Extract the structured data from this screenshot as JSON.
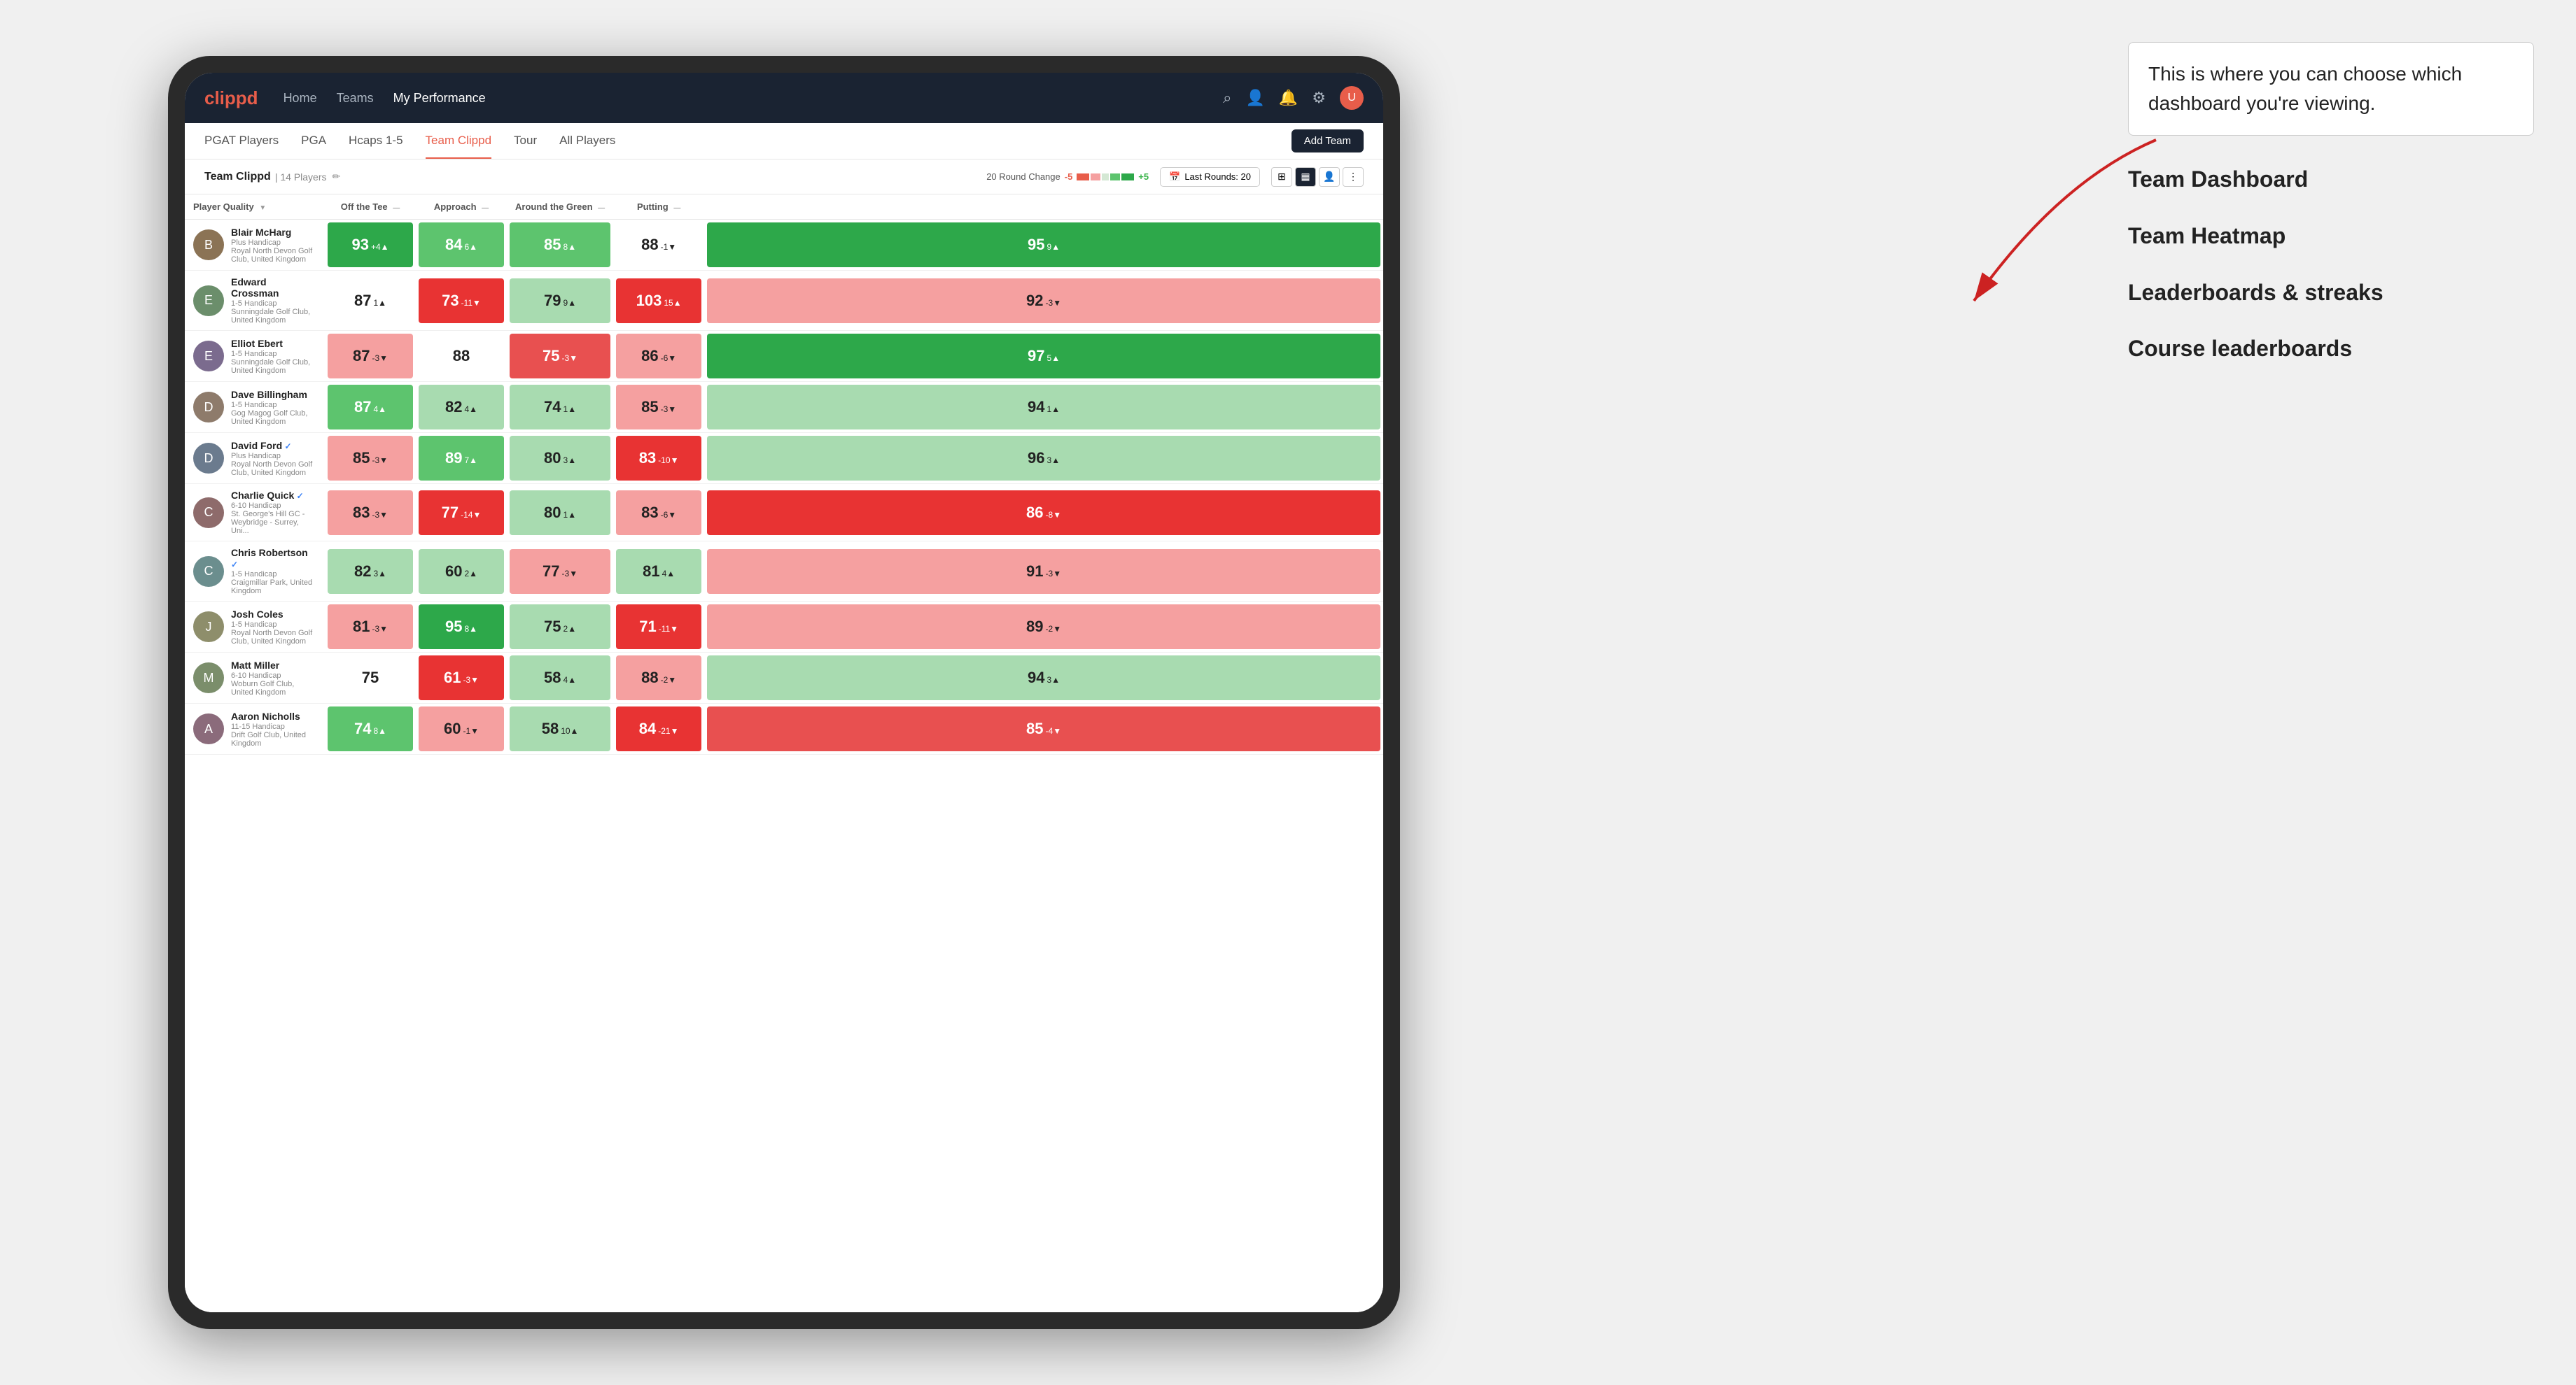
{
  "annotation": {
    "bubble_text": "This is where you can choose which dashboard you're viewing.",
    "items": [
      "Team Dashboard",
      "Team Heatmap",
      "Leaderboards & streaks",
      "Course leaderboards"
    ]
  },
  "nav": {
    "logo": "clippd",
    "links": [
      "Home",
      "Teams",
      "My Performance"
    ],
    "active_link": "My Performance"
  },
  "sub_nav": {
    "links": [
      "PGAT Players",
      "PGA",
      "Hcaps 1-5",
      "Team Clippd",
      "Tour",
      "All Players"
    ],
    "active": "Team Clippd",
    "add_team_label": "Add Team"
  },
  "team_header": {
    "name": "Team Clippd",
    "separator": "|",
    "count": "14 Players",
    "round_change_label": "20 Round Change",
    "change_neg": "-5",
    "change_pos": "+5",
    "last_rounds_label": "Last Rounds: 20"
  },
  "columns": {
    "player_quality": "Player Quality",
    "off_tee": "Off the Tee",
    "approach": "Approach",
    "around_green": "Around the Green",
    "putting": "Putting"
  },
  "players": [
    {
      "name": "Blair McHarg",
      "handicap": "Plus Handicap",
      "club": "Royal North Devon Golf Club, United Kingdom",
      "verified": false,
      "player_quality": {
        "value": 93,
        "change": "+4",
        "dir": "up",
        "color": "green-dark"
      },
      "off_tee": {
        "value": 84,
        "change": "6",
        "dir": "up",
        "color": "green-med"
      },
      "approach": {
        "value": 85,
        "change": "8",
        "dir": "up",
        "color": "green-med"
      },
      "around_green": {
        "value": 88,
        "change": "-1",
        "dir": "down",
        "color": "white-cell"
      },
      "putting": {
        "value": 95,
        "change": "9",
        "dir": "up",
        "color": "green-dark"
      }
    },
    {
      "name": "Edward Crossman",
      "handicap": "1-5 Handicap",
      "club": "Sunningdale Golf Club, United Kingdom",
      "verified": false,
      "player_quality": {
        "value": 87,
        "change": "1",
        "dir": "up",
        "color": "white-cell"
      },
      "off_tee": {
        "value": 73,
        "change": "-11",
        "dir": "down",
        "color": "red-dark"
      },
      "approach": {
        "value": 79,
        "change": "9",
        "dir": "up",
        "color": "green-light"
      },
      "around_green": {
        "value": 103,
        "change": "15",
        "dir": "up",
        "color": "red-dark"
      },
      "putting": {
        "value": 92,
        "change": "-3",
        "dir": "down",
        "color": "red-light"
      }
    },
    {
      "name": "Elliot Ebert",
      "handicap": "1-5 Handicap",
      "club": "Sunningdale Golf Club, United Kingdom",
      "verified": false,
      "player_quality": {
        "value": 87,
        "change": "-3",
        "dir": "down",
        "color": "red-light"
      },
      "off_tee": {
        "value": 88,
        "change": "",
        "dir": "none",
        "color": "white-cell"
      },
      "approach": {
        "value": 75,
        "change": "-3",
        "dir": "down",
        "color": "red-med"
      },
      "around_green": {
        "value": 86,
        "change": "-6",
        "dir": "down",
        "color": "red-light"
      },
      "putting": {
        "value": 97,
        "change": "5",
        "dir": "up",
        "color": "green-dark"
      }
    },
    {
      "name": "Dave Billingham",
      "handicap": "1-5 Handicap",
      "club": "Gog Magog Golf Club, United Kingdom",
      "verified": false,
      "player_quality": {
        "value": 87,
        "change": "4",
        "dir": "up",
        "color": "green-med"
      },
      "off_tee": {
        "value": 82,
        "change": "4",
        "dir": "up",
        "color": "green-light"
      },
      "approach": {
        "value": 74,
        "change": "1",
        "dir": "up",
        "color": "green-light"
      },
      "around_green": {
        "value": 85,
        "change": "-3",
        "dir": "down",
        "color": "red-light"
      },
      "putting": {
        "value": 94,
        "change": "1",
        "dir": "up",
        "color": "green-light"
      }
    },
    {
      "name": "David Ford",
      "handicap": "Plus Handicap",
      "club": "Royal North Devon Golf Club, United Kingdom",
      "verified": true,
      "player_quality": {
        "value": 85,
        "change": "-3",
        "dir": "down",
        "color": "red-light"
      },
      "off_tee": {
        "value": 89,
        "change": "7",
        "dir": "up",
        "color": "green-med"
      },
      "approach": {
        "value": 80,
        "change": "3",
        "dir": "up",
        "color": "green-light"
      },
      "around_green": {
        "value": 83,
        "change": "-10",
        "dir": "down",
        "color": "red-dark"
      },
      "putting": {
        "value": 96,
        "change": "3",
        "dir": "up",
        "color": "green-light"
      }
    },
    {
      "name": "Charlie Quick",
      "handicap": "6-10 Handicap",
      "club": "St. George's Hill GC - Weybridge - Surrey, Uni...",
      "verified": true,
      "player_quality": {
        "value": 83,
        "change": "-3",
        "dir": "down",
        "color": "red-light"
      },
      "off_tee": {
        "value": 77,
        "change": "-14",
        "dir": "down",
        "color": "red-dark"
      },
      "approach": {
        "value": 80,
        "change": "1",
        "dir": "up",
        "color": "green-light"
      },
      "around_green": {
        "value": 83,
        "change": "-6",
        "dir": "down",
        "color": "red-light"
      },
      "putting": {
        "value": 86,
        "change": "-8",
        "dir": "down",
        "color": "red-dark"
      }
    },
    {
      "name": "Chris Robertson",
      "handicap": "1-5 Handicap",
      "club": "Craigmillar Park, United Kingdom",
      "verified": true,
      "player_quality": {
        "value": 82,
        "change": "3",
        "dir": "up",
        "color": "green-light"
      },
      "off_tee": {
        "value": 60,
        "change": "2",
        "dir": "up",
        "color": "green-light"
      },
      "approach": {
        "value": 77,
        "change": "-3",
        "dir": "down",
        "color": "red-light"
      },
      "around_green": {
        "value": 81,
        "change": "4",
        "dir": "up",
        "color": "green-light"
      },
      "putting": {
        "value": 91,
        "change": "-3",
        "dir": "down",
        "color": "red-light"
      }
    },
    {
      "name": "Josh Coles",
      "handicap": "1-5 Handicap",
      "club": "Royal North Devon Golf Club, United Kingdom",
      "verified": false,
      "player_quality": {
        "value": 81,
        "change": "-3",
        "dir": "down",
        "color": "red-light"
      },
      "off_tee": {
        "value": 95,
        "change": "8",
        "dir": "up",
        "color": "green-dark"
      },
      "approach": {
        "value": 75,
        "change": "2",
        "dir": "up",
        "color": "green-light"
      },
      "around_green": {
        "value": 71,
        "change": "-11",
        "dir": "down",
        "color": "red-dark"
      },
      "putting": {
        "value": 89,
        "change": "-2",
        "dir": "down",
        "color": "red-light"
      }
    },
    {
      "name": "Matt Miller",
      "handicap": "6-10 Handicap",
      "club": "Woburn Golf Club, United Kingdom",
      "verified": false,
      "player_quality": {
        "value": 75,
        "change": "",
        "dir": "none",
        "color": "white-cell"
      },
      "off_tee": {
        "value": 61,
        "change": "-3",
        "dir": "down",
        "color": "red-dark"
      },
      "approach": {
        "value": 58,
        "change": "4",
        "dir": "up",
        "color": "green-light"
      },
      "around_green": {
        "value": 88,
        "change": "-2",
        "dir": "down",
        "color": "red-light"
      },
      "putting": {
        "value": 94,
        "change": "3",
        "dir": "up",
        "color": "green-light"
      }
    },
    {
      "name": "Aaron Nicholls",
      "handicap": "11-15 Handicap",
      "club": "Drift Golf Club, United Kingdom",
      "verified": false,
      "player_quality": {
        "value": 74,
        "change": "8",
        "dir": "up",
        "color": "green-med"
      },
      "off_tee": {
        "value": 60,
        "change": "-1",
        "dir": "down",
        "color": "red-light"
      },
      "approach": {
        "value": 58,
        "change": "10",
        "dir": "up",
        "color": "green-light"
      },
      "around_green": {
        "value": 84,
        "change": "-21",
        "dir": "down",
        "color": "red-dark"
      },
      "putting": {
        "value": 85,
        "change": "-4",
        "dir": "down",
        "color": "red-med"
      }
    }
  ]
}
